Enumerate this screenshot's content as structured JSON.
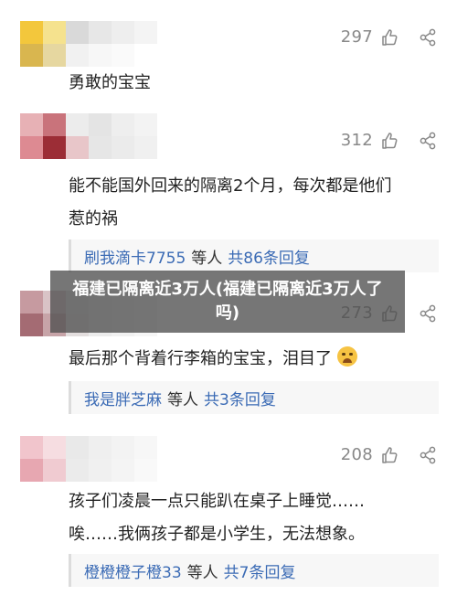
{
  "comments": [
    {
      "likes": "297",
      "text_lines": [
        "勇敢的宝宝"
      ],
      "mosaic_colors": [
        "#f3c73c",
        "#f5e28e",
        "#d9d9d9",
        "#e7e7e7",
        "#eeeeee",
        "#f4f4f4",
        "#d9b64f",
        "#e6d7a0",
        "#f1f1f1",
        "#f7f7f7",
        "#fafafa",
        "#ffffff"
      ]
    },
    {
      "likes": "312",
      "text_lines": [
        "能不能国外回来的隔离2个月，每次都是他们",
        "惹的祸"
      ],
      "reply": {
        "user": "刷我滴卡7755",
        "mid": "等人",
        "link": "共86条回复"
      },
      "mosaic_colors": [
        "#e7b1b5",
        "#c9737b",
        "#ececec",
        "#e4e4e4",
        "#eeeeee",
        "#f3f3f3",
        "#dd8a92",
        "#9c2d36",
        "#e8c6c9",
        "#e6e6e6",
        "#ebebeb",
        "#f0f0f0"
      ]
    },
    {
      "likes": "273",
      "text_lines": [
        "最后那个背着行李箱的宝宝，泪目了"
      ],
      "reply": {
        "user": "我是胖芝麻",
        "mid": "等人",
        "link": "共3条回复"
      },
      "mosaic_colors": [
        "#c69aa0",
        "#d9c3c6",
        "#e5e5e5",
        "#eeeeee",
        "#f2f2f2",
        "#f7f7f7",
        "#a46b73",
        "#c7a4a8",
        "#e3dede",
        "#ececec",
        "#f1f1f1",
        "#f6f6f6"
      ]
    },
    {
      "likes": "208",
      "text_lines": [
        "孩子们凌晨一点只能趴在桌子上睡觉……",
        "唉……我俩孩子都是小学生，无法想象。"
      ],
      "reply": {
        "user": "橙橙橙子橙33",
        "mid": "等人",
        "link": "共7条回复"
      },
      "mosaic_colors": [
        "#f1c5cc",
        "#f6dde1",
        "#e9e9e9",
        "#efefef",
        "#f3f3f3",
        "#f7f7f7",
        "#e7a7b1",
        "#f0cbd1",
        "#ebebeb",
        "#f0f0f0",
        "#f4f4f4",
        "#f9f9f9"
      ]
    }
  ],
  "overlay_caption": "福建已隔离近3万人(福建已隔离近3万人了吗)",
  "icons": {
    "like": "thumbs-up-icon",
    "share": "share-icon",
    "emoji": "crying-face-emoji"
  }
}
